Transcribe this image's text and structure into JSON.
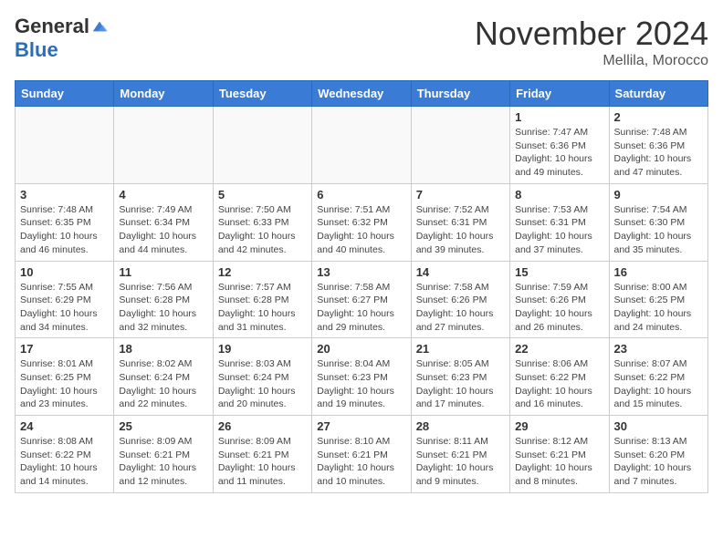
{
  "header": {
    "logo_general": "General",
    "logo_blue": "Blue",
    "month_title": "November 2024",
    "location": "Mellila, Morocco"
  },
  "calendar": {
    "days_of_week": [
      "Sunday",
      "Monday",
      "Tuesday",
      "Wednesday",
      "Thursday",
      "Friday",
      "Saturday"
    ],
    "weeks": [
      [
        {
          "day": "",
          "info": ""
        },
        {
          "day": "",
          "info": ""
        },
        {
          "day": "",
          "info": ""
        },
        {
          "day": "",
          "info": ""
        },
        {
          "day": "",
          "info": ""
        },
        {
          "day": "1",
          "info": "Sunrise: 7:47 AM\nSunset: 6:36 PM\nDaylight: 10 hours and 49 minutes."
        },
        {
          "day": "2",
          "info": "Sunrise: 7:48 AM\nSunset: 6:36 PM\nDaylight: 10 hours and 47 minutes."
        }
      ],
      [
        {
          "day": "3",
          "info": "Sunrise: 7:48 AM\nSunset: 6:35 PM\nDaylight: 10 hours and 46 minutes."
        },
        {
          "day": "4",
          "info": "Sunrise: 7:49 AM\nSunset: 6:34 PM\nDaylight: 10 hours and 44 minutes."
        },
        {
          "day": "5",
          "info": "Sunrise: 7:50 AM\nSunset: 6:33 PM\nDaylight: 10 hours and 42 minutes."
        },
        {
          "day": "6",
          "info": "Sunrise: 7:51 AM\nSunset: 6:32 PM\nDaylight: 10 hours and 40 minutes."
        },
        {
          "day": "7",
          "info": "Sunrise: 7:52 AM\nSunset: 6:31 PM\nDaylight: 10 hours and 39 minutes."
        },
        {
          "day": "8",
          "info": "Sunrise: 7:53 AM\nSunset: 6:31 PM\nDaylight: 10 hours and 37 minutes."
        },
        {
          "day": "9",
          "info": "Sunrise: 7:54 AM\nSunset: 6:30 PM\nDaylight: 10 hours and 35 minutes."
        }
      ],
      [
        {
          "day": "10",
          "info": "Sunrise: 7:55 AM\nSunset: 6:29 PM\nDaylight: 10 hours and 34 minutes."
        },
        {
          "day": "11",
          "info": "Sunrise: 7:56 AM\nSunset: 6:28 PM\nDaylight: 10 hours and 32 minutes."
        },
        {
          "day": "12",
          "info": "Sunrise: 7:57 AM\nSunset: 6:28 PM\nDaylight: 10 hours and 31 minutes."
        },
        {
          "day": "13",
          "info": "Sunrise: 7:58 AM\nSunset: 6:27 PM\nDaylight: 10 hours and 29 minutes."
        },
        {
          "day": "14",
          "info": "Sunrise: 7:58 AM\nSunset: 6:26 PM\nDaylight: 10 hours and 27 minutes."
        },
        {
          "day": "15",
          "info": "Sunrise: 7:59 AM\nSunset: 6:26 PM\nDaylight: 10 hours and 26 minutes."
        },
        {
          "day": "16",
          "info": "Sunrise: 8:00 AM\nSunset: 6:25 PM\nDaylight: 10 hours and 24 minutes."
        }
      ],
      [
        {
          "day": "17",
          "info": "Sunrise: 8:01 AM\nSunset: 6:25 PM\nDaylight: 10 hours and 23 minutes."
        },
        {
          "day": "18",
          "info": "Sunrise: 8:02 AM\nSunset: 6:24 PM\nDaylight: 10 hours and 22 minutes."
        },
        {
          "day": "19",
          "info": "Sunrise: 8:03 AM\nSunset: 6:24 PM\nDaylight: 10 hours and 20 minutes."
        },
        {
          "day": "20",
          "info": "Sunrise: 8:04 AM\nSunset: 6:23 PM\nDaylight: 10 hours and 19 minutes."
        },
        {
          "day": "21",
          "info": "Sunrise: 8:05 AM\nSunset: 6:23 PM\nDaylight: 10 hours and 17 minutes."
        },
        {
          "day": "22",
          "info": "Sunrise: 8:06 AM\nSunset: 6:22 PM\nDaylight: 10 hours and 16 minutes."
        },
        {
          "day": "23",
          "info": "Sunrise: 8:07 AM\nSunset: 6:22 PM\nDaylight: 10 hours and 15 minutes."
        }
      ],
      [
        {
          "day": "24",
          "info": "Sunrise: 8:08 AM\nSunset: 6:22 PM\nDaylight: 10 hours and 14 minutes."
        },
        {
          "day": "25",
          "info": "Sunrise: 8:09 AM\nSunset: 6:21 PM\nDaylight: 10 hours and 12 minutes."
        },
        {
          "day": "26",
          "info": "Sunrise: 8:09 AM\nSunset: 6:21 PM\nDaylight: 10 hours and 11 minutes."
        },
        {
          "day": "27",
          "info": "Sunrise: 8:10 AM\nSunset: 6:21 PM\nDaylight: 10 hours and 10 minutes."
        },
        {
          "day": "28",
          "info": "Sunrise: 8:11 AM\nSunset: 6:21 PM\nDaylight: 10 hours and 9 minutes."
        },
        {
          "day": "29",
          "info": "Sunrise: 8:12 AM\nSunset: 6:21 PM\nDaylight: 10 hours and 8 minutes."
        },
        {
          "day": "30",
          "info": "Sunrise: 8:13 AM\nSunset: 6:20 PM\nDaylight: 10 hours and 7 minutes."
        }
      ]
    ]
  }
}
